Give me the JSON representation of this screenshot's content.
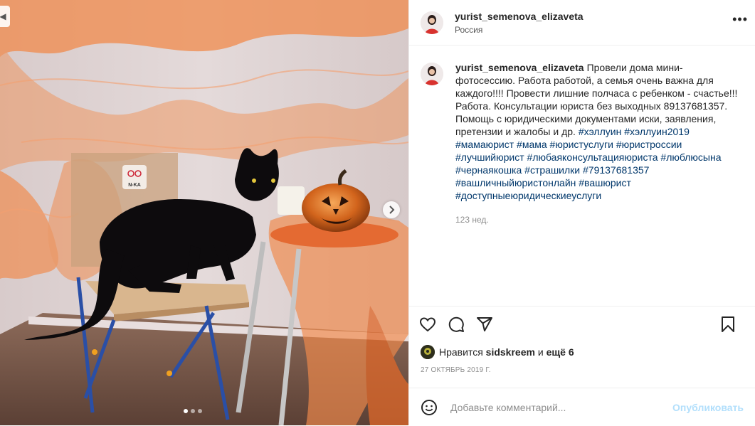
{
  "post": {
    "author": "yurist_semenova_elizaveta",
    "location": "Россия",
    "caption_text": "Провели дома мини-фотосессию. Работа работой, а семья очень важна для каждого!!!! Провести лишние полчаса с ребенком - счастье!!!Работа. Консультации юриста без выходных 89137681357. Помощь с юридическими документами иски, заявления, претензии и жалобы и др.",
    "hashtags": [
      "#хэллуин",
      "#хэллуин2019",
      "#мамаюрист",
      "#мама",
      "#юристуслуги",
      "#юристроссии",
      "#лучшийюрист",
      "#любаяконсультацияюриста",
      "#люблюсына",
      "#чернаякошка",
      "#страшилки",
      "#79137681357",
      "#вашличныйюристонлайн",
      "#вашюрист",
      "#доступныеюридическиеуслуги"
    ],
    "caption_age": "123 нед.",
    "likes_prefix": "Нравится",
    "liked_by": "sidskreem",
    "likes_and": "и",
    "likes_more": "ещё 6",
    "date": "27 ОКТЯБРЬ 2019 Г.",
    "photo_logo_text": "N-KA"
  },
  "comment_box": {
    "placeholder": "Добавьте комментарий...",
    "publish_label": "Опубликовать"
  },
  "carousel": {
    "count": 3,
    "active_index": 0
  },
  "icons": {
    "more": "more-dots-icon",
    "like": "heart-icon",
    "comment": "comment-bubble-icon",
    "share": "paper-plane-icon",
    "save": "bookmark-icon",
    "emoji": "smiley-icon",
    "next": "chevron-right-icon",
    "prev": "chevron-left-icon"
  },
  "colors": {
    "hashtag": "#00376b",
    "muted": "#8e8e8e",
    "publish_disabled": "#b2dffc",
    "text": "#262626"
  }
}
